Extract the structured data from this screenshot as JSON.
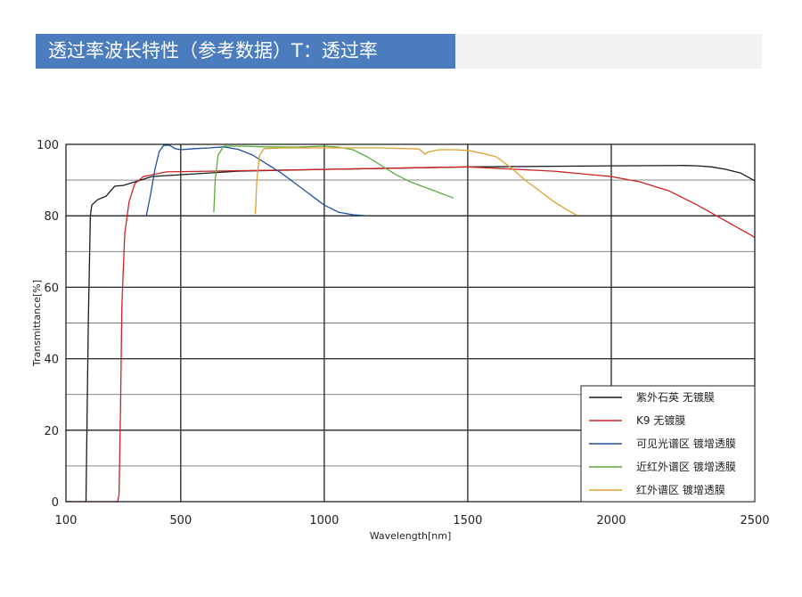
{
  "title": "透过率波长特性（参考数据）T：透过率",
  "chart_data": {
    "type": "line",
    "xlabel": "Wavelength[nm]",
    "ylabel": "Transmittance[%]",
    "xlim": [
      100,
      2500
    ],
    "ylim": [
      0,
      100
    ],
    "xticks": [
      100,
      500,
      1000,
      1500,
      2000,
      2500
    ],
    "yticks": [
      0,
      20,
      40,
      60,
      80,
      100
    ],
    "grid": true,
    "legend_position": "bottom-right",
    "series": [
      {
        "name": "紫外石英 无镀膜",
        "color": "#1a1a1a",
        "points": [
          [
            170,
            0
          ],
          [
            178,
            50
          ],
          [
            185,
            80
          ],
          [
            190,
            83
          ],
          [
            210,
            84.5
          ],
          [
            240,
            85.5
          ],
          [
            270,
            88.3
          ],
          [
            300,
            88.5
          ],
          [
            400,
            91
          ],
          [
            500,
            91.5
          ],
          [
            700,
            92.5
          ],
          [
            1000,
            93
          ],
          [
            1500,
            93.7
          ],
          [
            2000,
            94
          ],
          [
            2250,
            94.1
          ],
          [
            2300,
            94
          ],
          [
            2350,
            93.7
          ],
          [
            2400,
            93
          ],
          [
            2450,
            92
          ],
          [
            2500,
            89.8
          ]
        ]
      },
      {
        "name": "K9 无镀膜",
        "color": "#cc2222",
        "points": [
          [
            100,
            0
          ],
          [
            280,
            0
          ],
          [
            285,
            2
          ],
          [
            290,
            25
          ],
          [
            295,
            55
          ],
          [
            305,
            75
          ],
          [
            320,
            84
          ],
          [
            340,
            89
          ],
          [
            370,
            91
          ],
          [
            450,
            92.3
          ],
          [
            600,
            92.5
          ],
          [
            1000,
            93
          ],
          [
            1500,
            93.7
          ],
          [
            1800,
            92.5
          ],
          [
            2000,
            91
          ],
          [
            2100,
            89.5
          ],
          [
            2200,
            87
          ],
          [
            2300,
            83
          ],
          [
            2400,
            78.5
          ],
          [
            2500,
            74
          ]
        ]
      },
      {
        "name": "可见光谱区 镀增透膜",
        "color": "#1f4fa0",
        "points": [
          [
            380,
            80
          ],
          [
            395,
            86
          ],
          [
            410,
            93
          ],
          [
            425,
            98
          ],
          [
            440,
            99.7
          ],
          [
            460,
            99.8
          ],
          [
            480,
            98.8
          ],
          [
            500,
            98.5
          ],
          [
            550,
            98.8
          ],
          [
            600,
            99
          ],
          [
            650,
            99.3
          ],
          [
            700,
            98.6
          ],
          [
            750,
            97
          ],
          [
            800,
            94.5
          ],
          [
            850,
            92
          ],
          [
            900,
            89
          ],
          [
            950,
            86
          ],
          [
            1000,
            83
          ],
          [
            1050,
            81
          ],
          [
            1100,
            80.3
          ],
          [
            1150,
            80
          ]
        ]
      },
      {
        "name": "近红外谱区 镀增透膜",
        "color": "#5aaa3a",
        "points": [
          [
            615,
            81
          ],
          [
            620,
            90
          ],
          [
            630,
            97
          ],
          [
            650,
            99.5
          ],
          [
            700,
            99.5
          ],
          [
            800,
            99.3
          ],
          [
            900,
            99.2
          ],
          [
            1000,
            99.5
          ],
          [
            1050,
            99.2
          ],
          [
            1100,
            98.5
          ],
          [
            1150,
            96.5
          ],
          [
            1200,
            94
          ],
          [
            1250,
            91.5
          ],
          [
            1300,
            89.5
          ],
          [
            1350,
            88
          ],
          [
            1400,
            86.5
          ],
          [
            1450,
            85
          ]
        ]
      },
      {
        "name": "红外谱区 镀增透膜",
        "color": "#e0a030",
        "points": [
          [
            760,
            80.5
          ],
          [
            765,
            90
          ],
          [
            775,
            97
          ],
          [
            790,
            98.8
          ],
          [
            850,
            99
          ],
          [
            1000,
            99
          ],
          [
            1200,
            99
          ],
          [
            1330,
            98.7
          ],
          [
            1345,
            97.8
          ],
          [
            1350,
            97.2
          ],
          [
            1360,
            97.8
          ],
          [
            1400,
            98.5
          ],
          [
            1450,
            98.5
          ],
          [
            1500,
            98.3
          ],
          [
            1550,
            97.5
          ],
          [
            1600,
            96.5
          ],
          [
            1650,
            93.5
          ],
          [
            1700,
            90
          ],
          [
            1750,
            87
          ],
          [
            1800,
            84
          ],
          [
            1850,
            81.5
          ],
          [
            1880,
            80.2
          ]
        ]
      }
    ]
  }
}
